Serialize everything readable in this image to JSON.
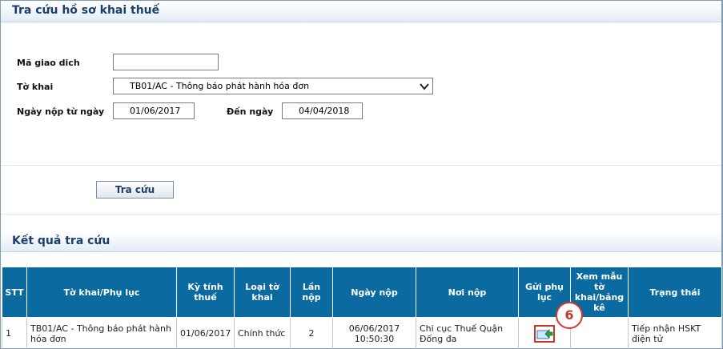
{
  "search": {
    "title": "Tra cứu hồ sơ khai thuế",
    "ma_giao_dich_label": "Mã giao dich",
    "ma_giao_dich_value": "",
    "to_khai_label": "Tờ khai",
    "to_khai_value": "TB01/AC - Thông báo phát hành hóa đơn",
    "ngay_nop_tu_label": "Ngày nộp từ ngày",
    "ngay_nop_tu_value": "01/06/2017",
    "den_ngay_label": "Đến ngày",
    "den_ngay_value": "04/04/2018",
    "search_button_label": "Tra cứu"
  },
  "results": {
    "title": "Kết quả tra cứu",
    "headers": {
      "stt": "STT",
      "to_khai": "Tờ khai/Phụ lục",
      "ky_tinh_thue": "Kỳ tính thuế",
      "loai_to_khai": "Loại tờ khai",
      "lan_nop": "Lần nộp",
      "ngay_nop": "Ngày nộp",
      "noi_nop": "Nơi nộp",
      "gui_phu_luc": "Gửi phụ lục",
      "xem_mau": "Xem mẫu tờ khai/bảng kê",
      "trang_thai": "Trạng thái"
    },
    "rows": [
      {
        "stt": "1",
        "to_khai": "TB01/AC - Thông báo phát hành hóa đơn",
        "ky_tinh_thue": "01/06/2017",
        "loai_to_khai": "Chính thức",
        "lan_nop": "2",
        "ngay_nop_date": "06/06/2017",
        "ngay_nop_time": "10:50:30",
        "noi_nop": "Chi cục Thuế Quận Đống đa",
        "gui_phu_luc_icon": "send-appendix-icon",
        "xem_mau": "",
        "trang_thai": "Tiếp nhận HSKT điện tử"
      }
    ]
  },
  "annotation": {
    "step_badge": "6"
  },
  "colors": {
    "header_bg": "#0b6ba1",
    "title_text": "#1b3f6b",
    "badge_red": "#d0392b",
    "link": "#1a4f9a"
  }
}
